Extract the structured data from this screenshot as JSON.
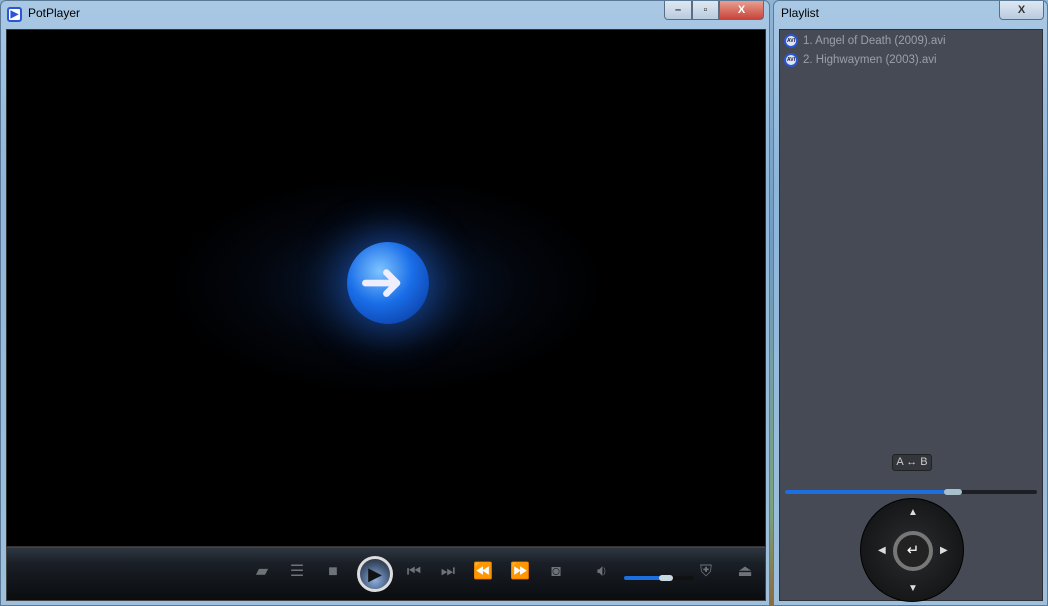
{
  "main_window": {
    "title": "PotPlayer",
    "icon": "potplayer-logo-icon",
    "minimize": "minimize-icon",
    "maximize": "maximize-icon",
    "close": "X"
  },
  "controls": {
    "icons": [
      "open-folder-icon",
      "playlist-icon",
      "stop-icon",
      "play-icon",
      "previous-icon",
      "next-icon",
      "rewind-icon",
      "fast-forward-icon",
      "camera-icon",
      "volume-icon",
      "equalizer-shield-icon",
      "eject-icon"
    ],
    "volume_percent": 62
  },
  "playlist_window": {
    "title": "Playlist",
    "close": "X",
    "items": [
      {
        "label": "1. Angel of Death (2009).avi",
        "icon": "avi-file-icon"
      },
      {
        "label": "2. Highwaymen (2003).avi",
        "icon": "avi-file-icon"
      }
    ],
    "ab_repeat": "A ↔ B",
    "seek_percent": 67,
    "dpad_icons": [
      "up-arrow-icon",
      "down-arrow-icon",
      "left-arrow-icon",
      "right-arrow-icon",
      "enter-icon"
    ]
  },
  "colors": {
    "accent": "#1d6fe0",
    "list_bg": "#464a54",
    "close_red": "#c8443a"
  }
}
